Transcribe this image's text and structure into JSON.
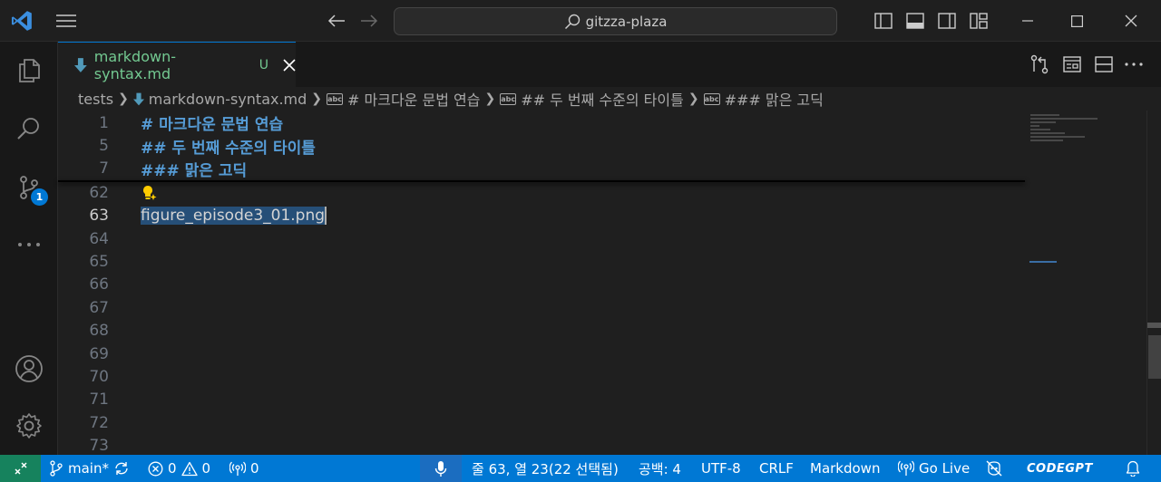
{
  "titlebar": {
    "search_text": "gitzza-plaza"
  },
  "activity_bar": {
    "source_control_badge": "1"
  },
  "tab": {
    "filename": "markdown-syntax.md",
    "status": "U"
  },
  "breadcrumb": {
    "folder": "tests",
    "file": "markdown-syntax.md",
    "symbol_label": "abc",
    "symbols": [
      "# 마크다운 문법 연습",
      "## 두 번째 수준의 타이틀",
      "### 맑은 고딕"
    ]
  },
  "editor": {
    "sticky_lines": [
      {
        "number": "1",
        "text": "# 마크다운 문법 연습"
      },
      {
        "number": "5",
        "text": "## 두 번째 수준의 타이틀"
      },
      {
        "number": "7",
        "text": "### 맑은 고딕"
      }
    ],
    "lines": [
      {
        "number": "62",
        "text": ""
      },
      {
        "number": "63",
        "text": "figure_episode3_01.png"
      },
      {
        "number": "64",
        "text": ""
      },
      {
        "number": "65",
        "text": ""
      },
      {
        "number": "66",
        "text": ""
      },
      {
        "number": "67",
        "text": ""
      },
      {
        "number": "68",
        "text": ""
      },
      {
        "number": "69",
        "text": ""
      },
      {
        "number": "70",
        "text": ""
      },
      {
        "number": "71",
        "text": ""
      },
      {
        "number": "72",
        "text": ""
      },
      {
        "number": "73",
        "text": ""
      }
    ]
  },
  "statusbar": {
    "branch": "main*",
    "errors": "0",
    "warnings": "0",
    "ports": "0",
    "position": "줄 63, 열 23(22 선택됨)",
    "indent": "공백: 4",
    "encoding": "UTF-8",
    "eol": "CRLF",
    "language": "Markdown",
    "live": "Go Live",
    "codegpt": "CODEGPT"
  },
  "colors": {
    "accent": "#0078d4",
    "remote": "#16825d",
    "heading": "#569cd6",
    "untracked": "#73c991",
    "selection": "#264f78"
  }
}
